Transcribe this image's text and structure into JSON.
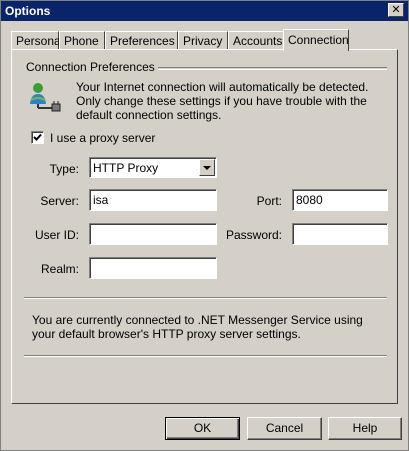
{
  "window": {
    "title": "Options"
  },
  "tabs": [
    {
      "label": "Personal"
    },
    {
      "label": "Phone"
    },
    {
      "label": "Preferences"
    },
    {
      "label": "Privacy"
    },
    {
      "label": "Accounts"
    },
    {
      "label": "Connection",
      "active": true
    }
  ],
  "connection": {
    "group_title": "Connection Preferences",
    "description": "Your Internet connection will automatically be detected.  Only change these settings if you have trouble with the default connection settings.",
    "icon": "network-user-icon",
    "use_proxy": {
      "label": "I use a proxy server",
      "checked": true
    },
    "type": {
      "label": "Type:",
      "value": "HTTP Proxy"
    },
    "server": {
      "label": "Server:",
      "value": "isa"
    },
    "port": {
      "label": "Port:",
      "value": "8080"
    },
    "user_id": {
      "label": "User ID:",
      "value": ""
    },
    "password": {
      "label": "Password:",
      "value": ""
    },
    "realm": {
      "label": "Realm:",
      "value": ""
    },
    "status_text": "You are currently connected to .NET Messenger Service using your default browser's HTTP proxy server settings."
  },
  "buttons": {
    "ok": "OK",
    "cancel": "Cancel",
    "help": "Help"
  }
}
